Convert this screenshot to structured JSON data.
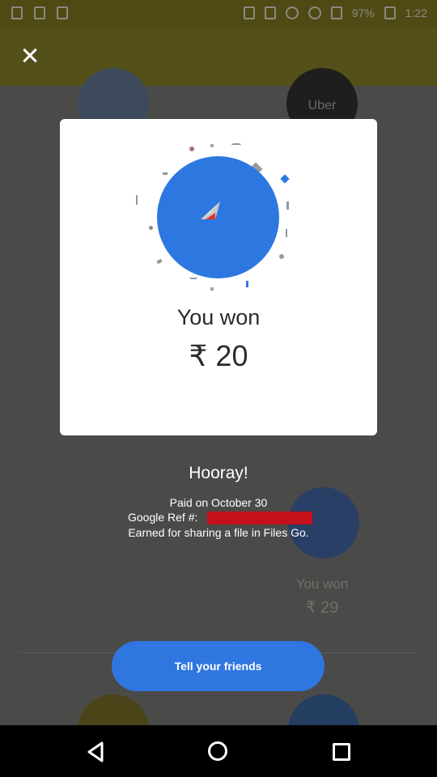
{
  "status_bar": {
    "battery": "97%",
    "time": "1:22"
  },
  "app_bar": {
    "close_icon": "close-icon"
  },
  "background": {
    "top_left_icon": "trophy-icon",
    "top_right_brand": "Uber",
    "right_card_label": "You won",
    "right_card_amount": "₹ 29"
  },
  "dialog": {
    "icon": "paper-plane-icon",
    "title": "You won",
    "amount": "₹ 20"
  },
  "result": {
    "headline": "Hooray!",
    "paid_on": "Paid on October 30",
    "ref_label": "Google Ref #:",
    "earned_for": "Earned for sharing a file in Files Go."
  },
  "cta": {
    "label": "Tell your friends"
  },
  "colors": {
    "accent_blue": "#2f76e0",
    "redaction": "#c4111b"
  }
}
